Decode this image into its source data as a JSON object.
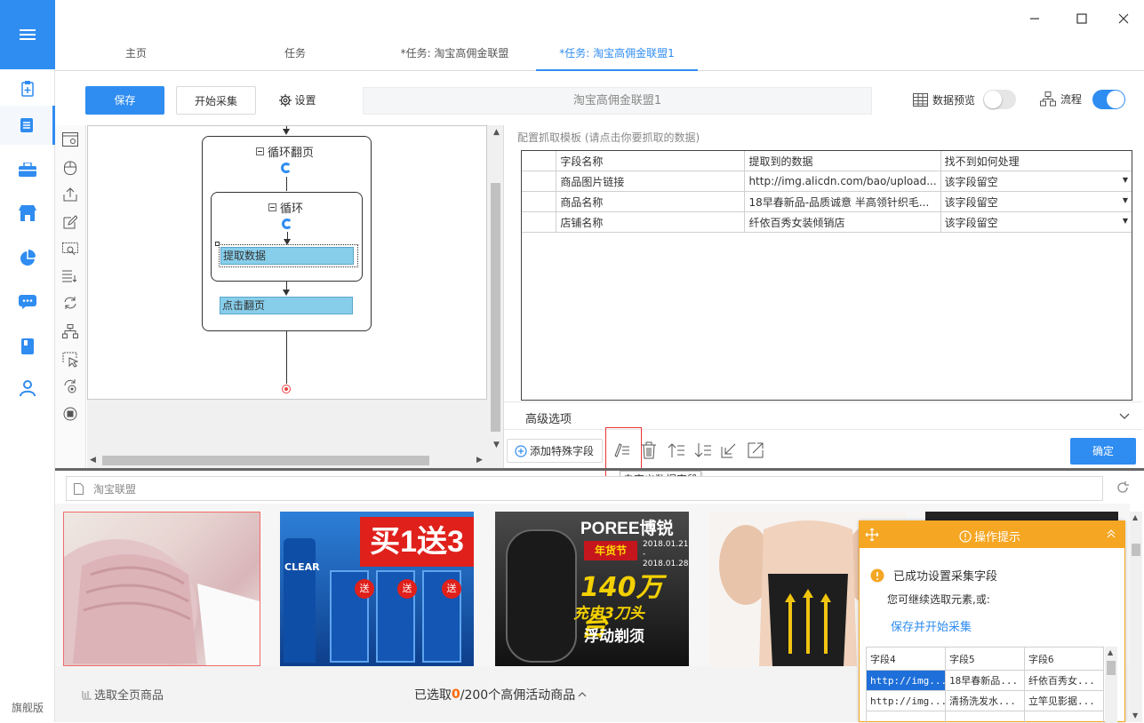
{
  "sidebar": {
    "edition_label": "旗舰版",
    "icons": [
      "menu-icon",
      "new-task-icon",
      "task-list-icon",
      "toolbox-icon",
      "store-icon",
      "chart-pie-icon",
      "message-icon",
      "book-icon",
      "user-icon"
    ]
  },
  "tabs": [
    {
      "label": "主页"
    },
    {
      "label": "任务"
    },
    {
      "label": "*任务: 淘宝高佣金联盟"
    },
    {
      "label": "*任务: 淘宝高佣金联盟1"
    }
  ],
  "toolbar": {
    "save_label": "保存",
    "start_label": "开始采集",
    "settings_label": "设置",
    "task_name": "淘宝高佣金联盟1",
    "data_preview_label": "数据预览",
    "data_preview_on": false,
    "flow_label": "流程",
    "flow_on": true
  },
  "flow": {
    "outer_loop_label": "循环翻页",
    "inner_loop_label": "循环",
    "extract_label": "提取数据",
    "click_next_label": "点击翻页"
  },
  "config": {
    "hint": "配置抓取模板 (请点击你要抓取的数据)",
    "columns": [
      "字段名称",
      "提取到的数据",
      "找不到如何处理"
    ],
    "rows": [
      {
        "name": "商品图片链接",
        "value": "http://img.alicdn.com/bao/upload...",
        "fallback": "该字段留空"
      },
      {
        "name": "商品名称",
        "value": "18早春新品-品质诚意 半高领针织毛...",
        "fallback": "该字段留空"
      },
      {
        "name": "店铺名称",
        "value": "纤依百秀女装倾销店",
        "fallback": "该字段留空"
      }
    ],
    "advanced_label": "高级选项",
    "add_special_label": "添加特殊字段",
    "custom_tooltip": "自定义数据字段",
    "confirm_label": "确定"
  },
  "browser": {
    "address": "淘宝联盟",
    "select_all_label": "选取全页商品",
    "selected_prefix": "已选取",
    "selected_count": "0",
    "selected_suffix": "/200个高佣活动商品"
  },
  "products": [
    {
      "banner": ""
    },
    {
      "banner": "买1送3",
      "brand": "CLEAR",
      "tag": "送"
    },
    {
      "banner": "POREE博锐",
      "promo": "年货节",
      "dates": "2018.01.21 - 2018.01.28",
      "big": "140万台",
      "line1": "充电3刀头",
      "line2": "浮动剃须"
    },
    {
      "banner": ""
    }
  ],
  "tips": {
    "title": "操作提示",
    "success": "已成功设置采集字段",
    "continue": "您可继续选取元素,或:",
    "save_start_link": "保存并开始采集",
    "preview_headers": [
      "字段4",
      "字段5",
      "字段6"
    ],
    "preview_rows": [
      [
        "http://img...",
        "18早春新品...",
        "纤依百秀女..."
      ],
      [
        "http://img...",
        "清扬洗发水...",
        "立竿见影据..."
      ]
    ]
  },
  "colors": {
    "accent": "#2f8cf0",
    "tip_header": "#f5a623",
    "step_fill": "#87ceeb"
  }
}
